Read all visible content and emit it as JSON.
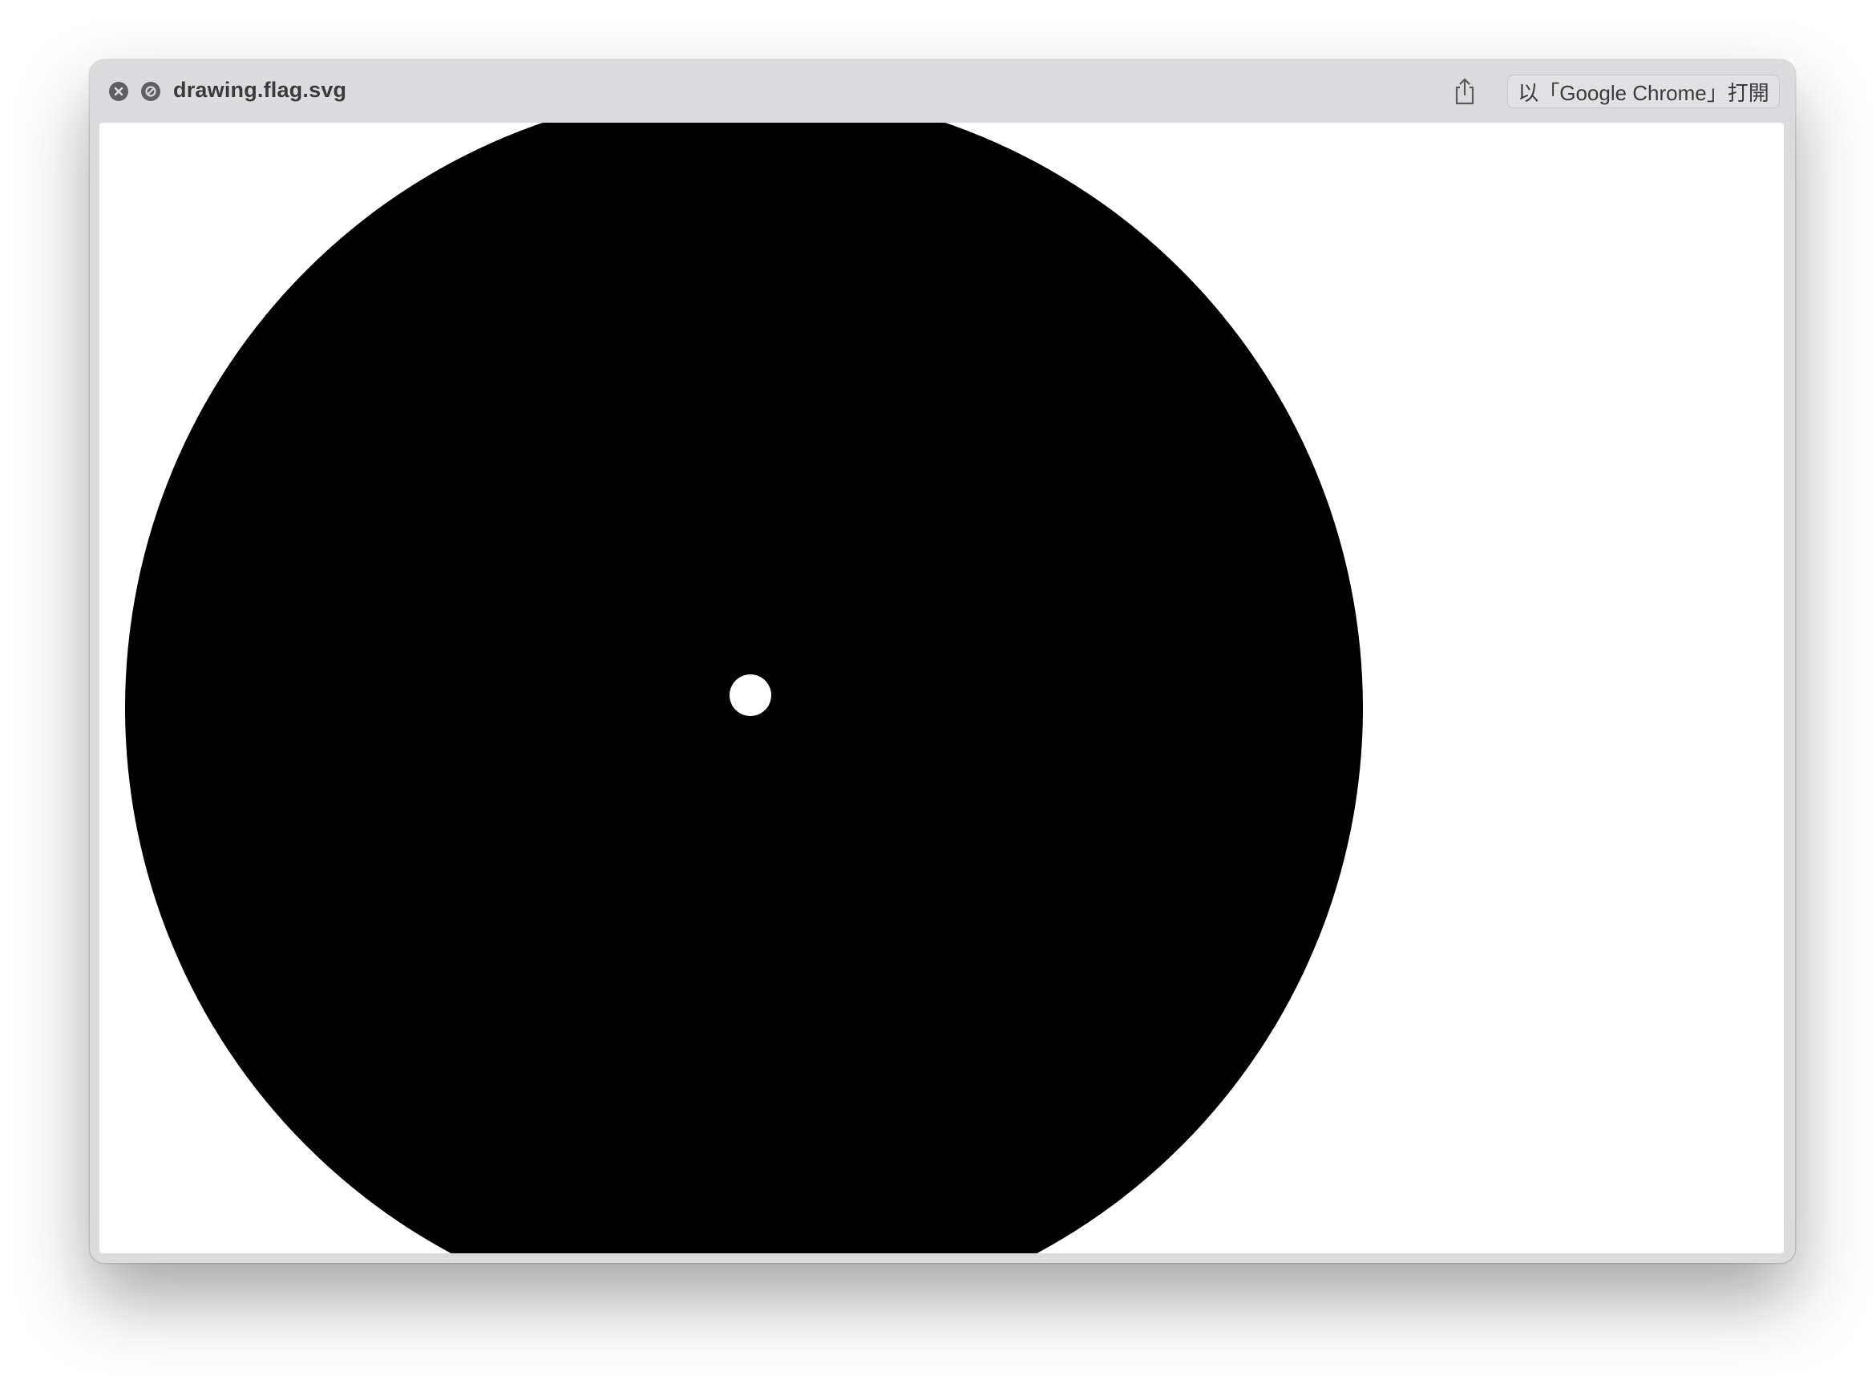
{
  "window": {
    "title": "drawing.flag.svg",
    "open_with_label": "以「Google Chrome」打開"
  },
  "icons": {
    "close": "close-icon",
    "minimize": "minimize-icon",
    "share": "share-icon"
  },
  "document": {
    "shapes": [
      "large-black-circle",
      "small-white-circle"
    ],
    "colors": {
      "background": "#ffffff",
      "circle_fill": "#000000",
      "dot_fill": "#ffffff"
    }
  }
}
